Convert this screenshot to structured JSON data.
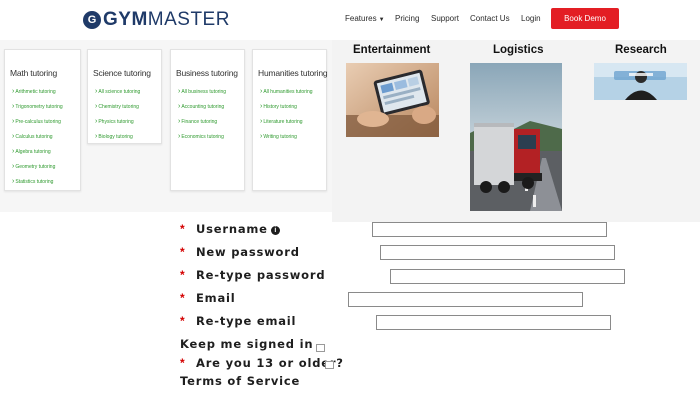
{
  "nav": {
    "logo_mark": "G",
    "logo_bold": "GYM",
    "logo_thin": "MASTER",
    "items": [
      "Features",
      "Pricing",
      "Support",
      "Contact Us",
      "Login"
    ],
    "demo_button": "Book Demo"
  },
  "tutoring": [
    {
      "title": "Math tutoring",
      "links": [
        "Arithmetic tutoring",
        "Trigonometry tutoring",
        "Pre-calculus tutoring",
        "Calculus tutoring",
        "Algebra tutoring",
        "Geometry tutoring",
        "Statistics tutoring"
      ]
    },
    {
      "title": "Science tutoring",
      "links": [
        "All science tutoring",
        "Chemistry tutoring",
        "Physics tutoring",
        "Biology tutoring"
      ]
    },
    {
      "title": "Business tutoring",
      "links": [
        "All business tutoring",
        "Accounting tutoring",
        "Finance tutoring",
        "Economics tutoring"
      ]
    },
    {
      "title": "Humanities tutoring",
      "links": [
        "All humanities tutoring",
        "History tutoring",
        "Literature tutoring",
        "Writing tutoring"
      ]
    }
  ],
  "industries": {
    "entertainment": "Entertainment",
    "logistics": "Logistics",
    "research": "Research"
  },
  "form": {
    "username": "Username",
    "info_glyph": "i",
    "new_password": "New password",
    "retype_password": "Re-type password",
    "email": "Email",
    "retype_email": "Re-type email",
    "keep_signed_in": "Keep me signed in",
    "age_check": "Are you 13 or older?",
    "terms": "Terms of Service",
    "required_mark": "*"
  },
  "colors": {
    "brand": "#1f3a68",
    "demo_button": "#e31e24",
    "link_green": "#2f9a2f",
    "required_red": "#d40000"
  }
}
